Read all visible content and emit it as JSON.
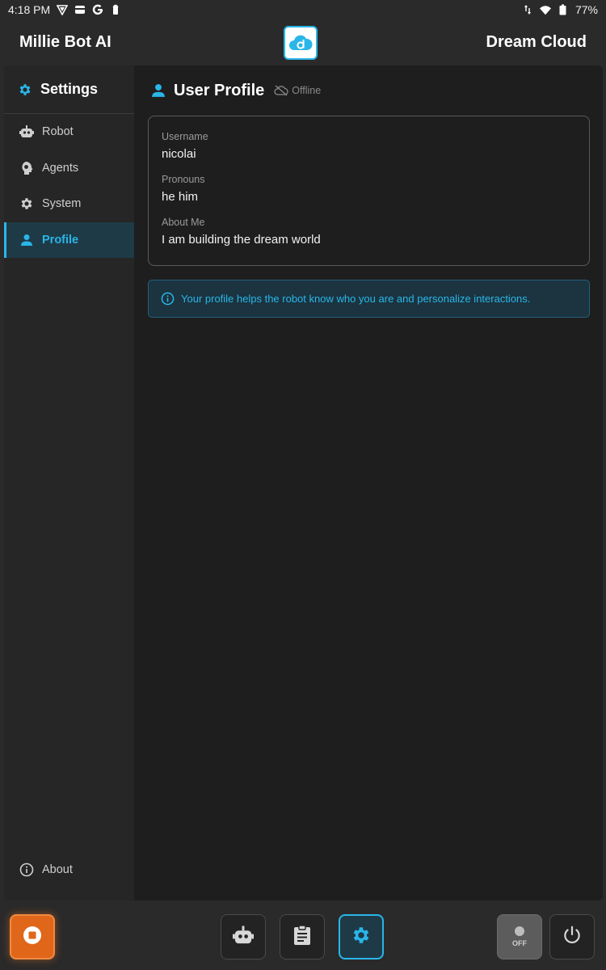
{
  "status_bar": {
    "time": "4:18 PM",
    "battery": "77%",
    "icons": [
      "vpn-icon",
      "card-icon",
      "google-icon",
      "keyhole-icon",
      "data-arrows-icon",
      "wifi-icon",
      "battery-icon"
    ]
  },
  "header": {
    "left_title": "Millie Bot AI",
    "right_title": "Dream Cloud",
    "logo_icon": "dream-cloud-logo-icon"
  },
  "sidebar": {
    "title": "Settings",
    "items": [
      {
        "label": "Robot",
        "icon": "robot-icon"
      },
      {
        "label": "Agents",
        "icon": "head-icon"
      },
      {
        "label": "System",
        "icon": "gear-icon"
      },
      {
        "label": "Profile",
        "icon": "person-icon",
        "active": true
      }
    ],
    "about_label": "About"
  },
  "content": {
    "title": "User Profile",
    "status": "Offline",
    "fields": [
      {
        "label": "Username",
        "value": "nicolai"
      },
      {
        "label": "Pronouns",
        "value": "he him"
      },
      {
        "label": "About Me",
        "value": "I am building the dream world"
      }
    ],
    "info_text": "Your profile helps the robot know who you are and personalize interactions."
  },
  "bottom_bar": {
    "off_label": "OFF",
    "buttons": [
      "stop-button",
      "robot-button",
      "clipboard-button",
      "settings-button",
      "off-toggle",
      "power-button"
    ]
  },
  "colors": {
    "accent": "#29b6e8",
    "stop": "#e0661a",
    "background": "#1e1e1e"
  }
}
